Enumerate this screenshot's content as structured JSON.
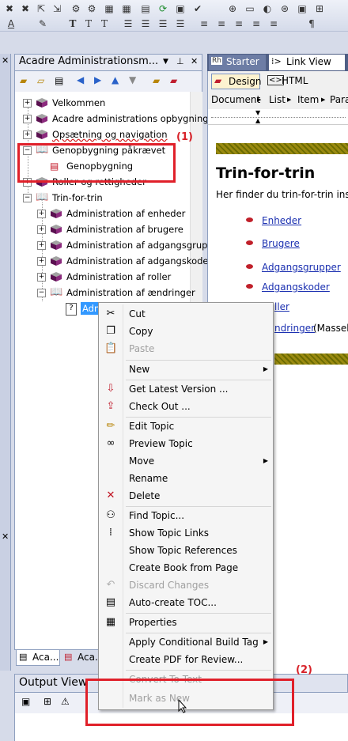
{
  "toc_pane": {
    "title": "Acadre Administrationsm...",
    "items": [
      {
        "label": "Velkommen"
      },
      {
        "label": "Acadre administrations opbygning"
      },
      {
        "label": "Opsætning og navigation"
      },
      {
        "label": "Genopbygning påkrævet"
      },
      {
        "label": "Genopbygning"
      },
      {
        "label": "Roller og rettigheder"
      },
      {
        "label": "Trin-for-trin"
      },
      {
        "label": "Administration af enheder"
      },
      {
        "label": "Administration af brugere"
      },
      {
        "label": "Administration af adgangsgrupper"
      },
      {
        "label": "Administration af adgangskoder"
      },
      {
        "label": "Administration af roller"
      },
      {
        "label": "Administration af ændringer"
      },
      {
        "label": "Admi"
      }
    ],
    "bottom_tabs": [
      "Aca...",
      "Aca..."
    ]
  },
  "output_view": {
    "title": "Output View"
  },
  "editor": {
    "tabs": [
      "Starter",
      "Link View"
    ],
    "modes": [
      "Design",
      "HTML"
    ],
    "menu": [
      "Document",
      "List",
      "Item",
      "Para"
    ],
    "heading": "Trin-for-trin",
    "intro": "Her finder du trin-for-trin inst",
    "links": [
      "Enheder",
      "Brugere",
      "Adgangsgrupper",
      "Adgangskoder",
      "ller",
      "ndringer"
    ],
    "links_suffix": "(Masseb"
  },
  "context_menu": {
    "items": [
      {
        "label": "Cut"
      },
      {
        "label": "Copy"
      },
      {
        "label": "Paste"
      },
      {
        "label": "New"
      },
      {
        "label": "Get Latest Version ..."
      },
      {
        "label": "Check Out ..."
      },
      {
        "label": "Edit Topic"
      },
      {
        "label": "Preview Topic"
      },
      {
        "label": "Move"
      },
      {
        "label": "Rename"
      },
      {
        "label": "Delete"
      },
      {
        "label": "Find Topic..."
      },
      {
        "label": "Show Topic Links"
      },
      {
        "label": "Show Topic References"
      },
      {
        "label": "Create Book from Page"
      },
      {
        "label": "Discard Changes"
      },
      {
        "label": "Auto-create TOC..."
      },
      {
        "label": "Properties"
      },
      {
        "label": "Apply Conditional Build Tag"
      },
      {
        "label": "Create PDF for Review..."
      },
      {
        "label": "Convert To Text"
      },
      {
        "label": "Mark as New"
      }
    ]
  },
  "annotations": {
    "one": "(1)",
    "two": "(2)"
  },
  "colors": {
    "red": "#e0202a",
    "book": "#7a1f6e",
    "link": "#1a2fb0"
  }
}
